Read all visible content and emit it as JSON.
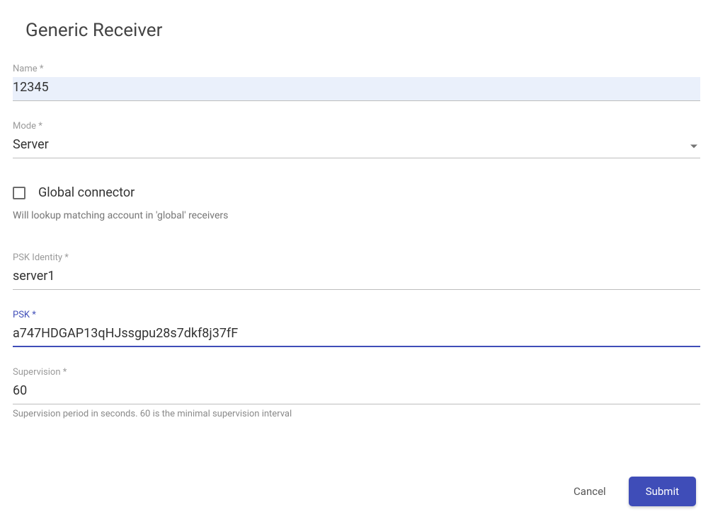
{
  "title": "Generic Receiver",
  "fields": {
    "name": {
      "label": "Name *",
      "value": "12345"
    },
    "mode": {
      "label": "Mode *",
      "value": "Server"
    },
    "global_connector": {
      "label": "Global connector",
      "helper": "Will lookup matching account in 'global' receivers",
      "checked": false
    },
    "psk_identity": {
      "label": "PSK Identity *",
      "value": "server1"
    },
    "psk": {
      "label": "PSK *",
      "value": "a747HDGAP13qHJssgpu28s7dkf8j37fF"
    },
    "supervision": {
      "label": "Supervision *",
      "value": "60",
      "helper": "Supervision period in seconds. 60 is the minimal supervision interval"
    }
  },
  "buttons": {
    "cancel": "Cancel",
    "submit": "Submit"
  }
}
